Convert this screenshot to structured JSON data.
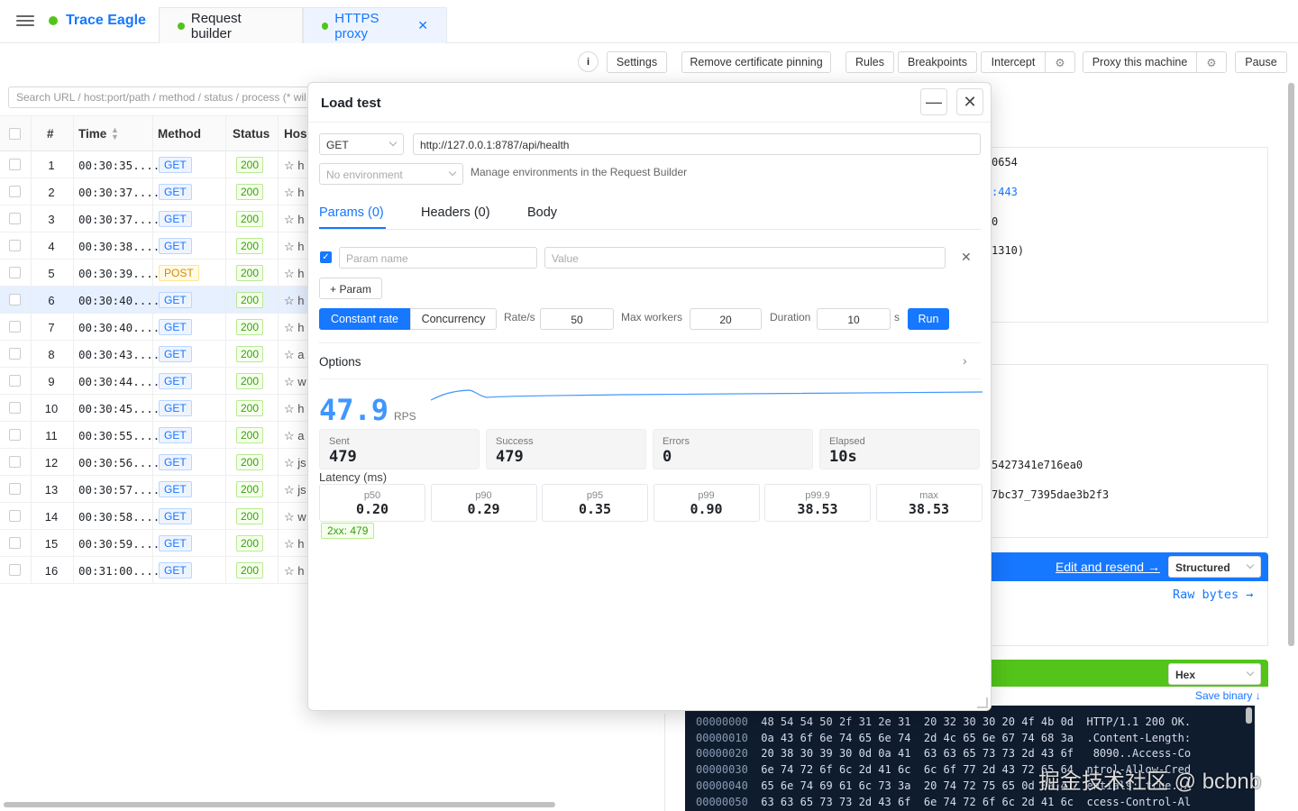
{
  "app": {
    "name": "Trace Eagle"
  },
  "tabs": [
    {
      "label": "Request builder"
    },
    {
      "label": "HTTPS proxy"
    }
  ],
  "toolbar": {
    "info": "i",
    "settings": "Settings",
    "remove_pinning": "Remove certificate pinning",
    "rules": "Rules",
    "breakpoints": "Breakpoints",
    "intercept": "Intercept",
    "proxy_machine": "Proxy this machine",
    "pause": "Pause"
  },
  "search": {
    "placeholder": "Search URL / host:port/path / method / status / process (* wil"
  },
  "table": {
    "headers": {
      "num": "#",
      "time": "Time",
      "method": "Method",
      "status": "Status",
      "host": "Hos"
    },
    "rows": [
      {
        "num": "1",
        "time": "00:30:35....",
        "method": "GET",
        "status": "200",
        "host": "☆ h"
      },
      {
        "num": "2",
        "time": "00:30:37....",
        "method": "GET",
        "status": "200",
        "host": "☆ h"
      },
      {
        "num": "3",
        "time": "00:30:37....",
        "method": "GET",
        "status": "200",
        "host": "☆ h"
      },
      {
        "num": "4",
        "time": "00:30:38....",
        "method": "GET",
        "status": "200",
        "host": "☆ h"
      },
      {
        "num": "5",
        "time": "00:30:39....",
        "method": "POST",
        "status": "200",
        "host": "☆ h"
      },
      {
        "num": "6",
        "time": "00:30:40....",
        "method": "GET",
        "status": "200",
        "host": "☆ h"
      },
      {
        "num": "7",
        "time": "00:30:40....",
        "method": "GET",
        "status": "200",
        "host": "☆ h"
      },
      {
        "num": "8",
        "time": "00:30:43....",
        "method": "GET",
        "status": "200",
        "host": "☆ a"
      },
      {
        "num": "9",
        "time": "00:30:44....",
        "method": "GET",
        "status": "200",
        "host": "☆ w"
      },
      {
        "num": "10",
        "time": "00:30:45....",
        "method": "GET",
        "status": "200",
        "host": "☆ h"
      },
      {
        "num": "11",
        "time": "00:30:55....",
        "method": "GET",
        "status": "200",
        "host": "☆ a"
      },
      {
        "num": "12",
        "time": "00:30:56....",
        "method": "GET",
        "status": "200",
        "host": "☆ js"
      },
      {
        "num": "13",
        "time": "00:30:57....",
        "method": "GET",
        "status": "200",
        "host": "☆ js"
      },
      {
        "num": "14",
        "time": "00:30:58....",
        "method": "GET",
        "status": "200",
        "host": "☆ w"
      },
      {
        "num": "15",
        "time": "00:30:59....",
        "method": "GET",
        "status": "200",
        "host": "☆ h"
      },
      {
        "num": "16",
        "time": "00:31:00....",
        "method": "GET",
        "status": "200",
        "host": "☆ h"
      }
    ]
  },
  "detail": {
    "line1": "0654",
    "line2": ":443",
    "line3": "0",
    "line4": "1310)",
    "hash1": "5427341e716ea0",
    "hash2": "7bc37_7395dae3b2f3",
    "edit_resend": "Edit and resend →",
    "structured": "Structured",
    "raw_bytes": "Raw bytes →",
    "hex": "Hex",
    "save_binary": "Save binary ↓",
    "hex_rows": [
      {
        "off": "00000000",
        "bytes": "48 54 54 50 2f 31 2e 31  20 32 30 30 20 4f 4b 0d",
        "ascii": "HTTP/1.1 200 OK."
      },
      {
        "off": "00000010",
        "bytes": "0a 43 6f 6e 74 65 6e 74  2d 4c 65 6e 67 74 68 3a",
        "ascii": ".Content-Length:"
      },
      {
        "off": "00000020",
        "bytes": "20 38 30 39 30 0d 0a 41  63 63 65 73 73 2d 43 6f",
        "ascii": " 8090..Access-Co"
      },
      {
        "off": "00000030",
        "bytes": "6e 74 72 6f 6c 2d 41 6c  6c 6f 77 2d 43 72 65 64",
        "ascii": "ntrol-Allow-Cred"
      },
      {
        "off": "00000040",
        "bytes": "65 6e 74 69 61 6c 73 3a  20 74 72 75 65 0d 0a 41",
        "ascii": "entials: true..A"
      },
      {
        "off": "00000050",
        "bytes": "63 63 65 73 73 2d 43 6f  6e 74 72 6f 6c 2d 41 6c",
        "ascii": "ccess-Control-Al"
      }
    ],
    "watermark": "掘金技术社区 @ bcbnb"
  },
  "modal": {
    "title": "Load test",
    "method": "GET",
    "url": "http://127.0.0.1:8787/api/health",
    "environment": "No environment",
    "env_hint": "Manage environments in the Request Builder",
    "tabs": {
      "params": "Params (0)",
      "headers": "Headers (0)",
      "body": "Body"
    },
    "param_name_placeholder": "Param name",
    "value_placeholder": "Value",
    "add_param": "+ Param",
    "mode_constant": "Constant rate",
    "mode_concurrency": "Concurrency",
    "rate_label": "Rate/s",
    "rate": "50",
    "workers_label": "Max workers",
    "workers": "20",
    "duration_label": "Duration",
    "duration": "10",
    "duration_unit": "s",
    "run": "Run",
    "options": "Options",
    "rps": "47.9",
    "rps_unit": "RPS",
    "stats": [
      {
        "label": "Sent",
        "value": "479"
      },
      {
        "label": "Success",
        "value": "479"
      },
      {
        "label": "Errors",
        "value": "0"
      },
      {
        "label": "Elapsed",
        "value": "10s"
      }
    ],
    "latency_title": "Latency (ms)",
    "latency": [
      {
        "label": "p50",
        "value": "0.20"
      },
      {
        "label": "p90",
        "value": "0.29"
      },
      {
        "label": "p95",
        "value": "0.35"
      },
      {
        "label": "p99",
        "value": "0.90"
      },
      {
        "label": "p99.9",
        "value": "38.53"
      },
      {
        "label": "max",
        "value": "38.53"
      }
    ],
    "status_badge": "2xx: 479"
  },
  "colors": {
    "accent": "#1677ff",
    "success": "#52c41a",
    "hex_bg": "#0f1c2e"
  }
}
